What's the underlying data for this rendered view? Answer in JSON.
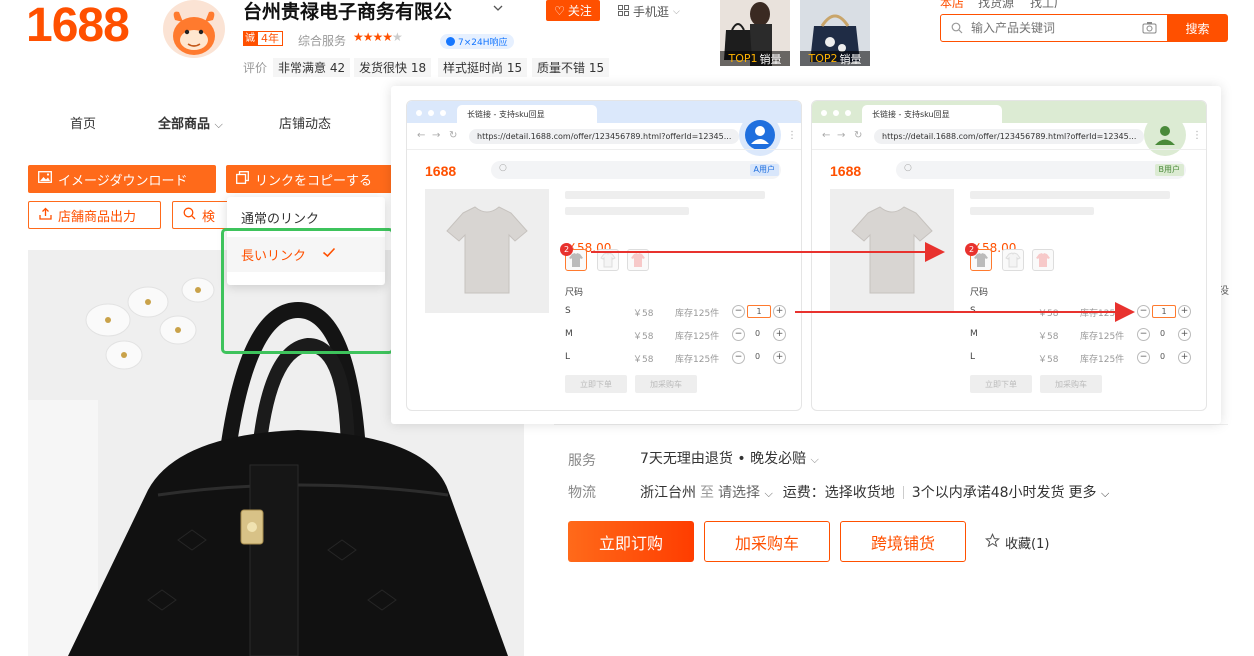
{
  "header": {
    "logo": "1688",
    "shop_name": "台州贵禄电子商务有限公",
    "follow_label": "关注",
    "mobile_label": "手机逛",
    "years_badge": "4年",
    "rating_label": "综合服务",
    "stars": "★★★★",
    "response_badge": "7×24H响应",
    "eval_label": "评价",
    "eval_tags": [
      "非常满意 42",
      "发货很快 18",
      "样式挺时尚 15",
      "质量不错 15"
    ],
    "thumbs": [
      {
        "rank": "TOP1",
        "label": "销量"
      },
      {
        "rank": "TOP2",
        "label": "销量"
      }
    ],
    "top_links": [
      "本店",
      "找货源",
      "找工厂"
    ],
    "search_placeholder": "输入产品关键词",
    "search_button": "搜索"
  },
  "nav": {
    "items": [
      "首页",
      "全部商品",
      "店铺动态"
    ]
  },
  "actions": {
    "image_download": "イメージダウンロード",
    "copy_link": "リンクをコピーする",
    "export_products": "店舗商品出力",
    "search_partial": "検"
  },
  "dropdown": {
    "items": [
      "通常のリンク",
      "長いリンク"
    ],
    "selected_index": 1
  },
  "tutorial": {
    "windows": [
      {
        "tab_title": "长链接 - 支持sku回显",
        "url": "https://detail.1688.com/offer/123456789.html?offerId=12345...",
        "user_tag": "A用户",
        "accent": "#dbe8fb",
        "user_color": "#1f6fde",
        "tag_bg": "#d8e6fb",
        "tag_fg": "#1f6fde",
        "selected_qty_row": 0
      },
      {
        "tab_title": "长链接 - 支持sku回显",
        "url": "https://detail.1688.com/offer/123456789.html?offerId=12345...",
        "user_tag": "B用户",
        "accent": "#dcebd3",
        "user_color": "#4a8a3a",
        "tag_bg": "#dcebd3",
        "tag_fg": "#4a8a3a",
        "selected_qty_row": 0
      }
    ],
    "logo": "1688",
    "price": "￥58.00",
    "badge_count": "2",
    "size_label": "尺码",
    "sizes": [
      {
        "size": "S",
        "price": "￥58",
        "stock": "库存125件",
        "qty": "1"
      },
      {
        "size": "M",
        "price": "￥58",
        "stock": "库存125件",
        "qty": "0"
      },
      {
        "size": "L",
        "price": "￥58",
        "stock": "库存125件",
        "qty": "0"
      }
    ],
    "btn_buy": "立即下单",
    "btn_cart": "加采购车"
  },
  "details": {
    "service_label": "服务",
    "service_value": "7天无理由退货 • 晚发必赔",
    "logistics_label": "物流",
    "origin": "浙江台州",
    "to": "至",
    "choose": "请选择",
    "freight": "运费：选择收货地",
    "promise": "3个以内承诺48小时发货",
    "more": "更多",
    "side_char": "没"
  },
  "buttons": {
    "buy": "立即订购",
    "cart": "加采购车",
    "cross": "跨境铺货",
    "favorite": "收藏(1)"
  },
  "colors": {
    "brand": "#ff5000",
    "highlight": "#3ec35c",
    "arrow": "#e8322e"
  }
}
